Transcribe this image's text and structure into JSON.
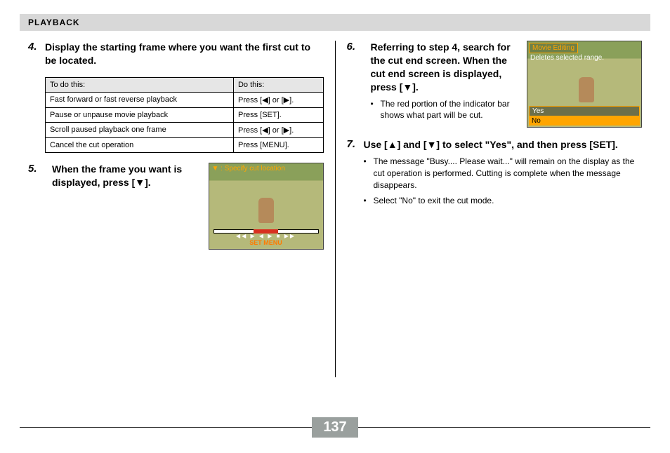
{
  "header": "PLAYBACK",
  "page_number": "137",
  "left": {
    "step4": {
      "num": "4.",
      "title": "Display the starting frame where you want the first cut to be located.",
      "table": {
        "headers": [
          "To do this:",
          "Do this:"
        ],
        "rows": [
          [
            "Fast forward or fast reverse playback",
            "Press [◀] or [▶]."
          ],
          [
            "Pause or unpause movie playback",
            "Press [SET]."
          ],
          [
            "Scroll paused playback one frame",
            "Press [◀] or [▶]."
          ],
          [
            "Cancel the cut operation",
            "Press [MENU]."
          ]
        ]
      }
    },
    "step5": {
      "num": "5.",
      "title": "When the frame you want is displayed, press [▼].",
      "thumb": {
        "caption": "▼ : Specify cut location",
        "controls_icons": "◀◀  ▶  ◀  ▶  ■  ▶▶",
        "controls_text": "SET      MENU"
      }
    }
  },
  "right": {
    "step6": {
      "num": "6.",
      "title": "Referring to step 4, search for the cut end screen. When the cut end screen is displayed, press [▼].",
      "bullet": "The red portion of the indicator bar shows what part will be cut.",
      "thumb": {
        "badge": "Movie Editing",
        "subtitle": "Deletes selected range.",
        "opt_yes": "Yes",
        "opt_no": "No"
      }
    },
    "step7": {
      "num": "7.",
      "title": "Use [▲] and [▼] to select \"Yes\", and then press [SET].",
      "bullets": [
        "The message \"Busy.... Please wait...\" will remain on the display as the cut operation is performed. Cutting is complete when the message disappears.",
        "Select \"No\" to exit the cut mode."
      ]
    }
  }
}
